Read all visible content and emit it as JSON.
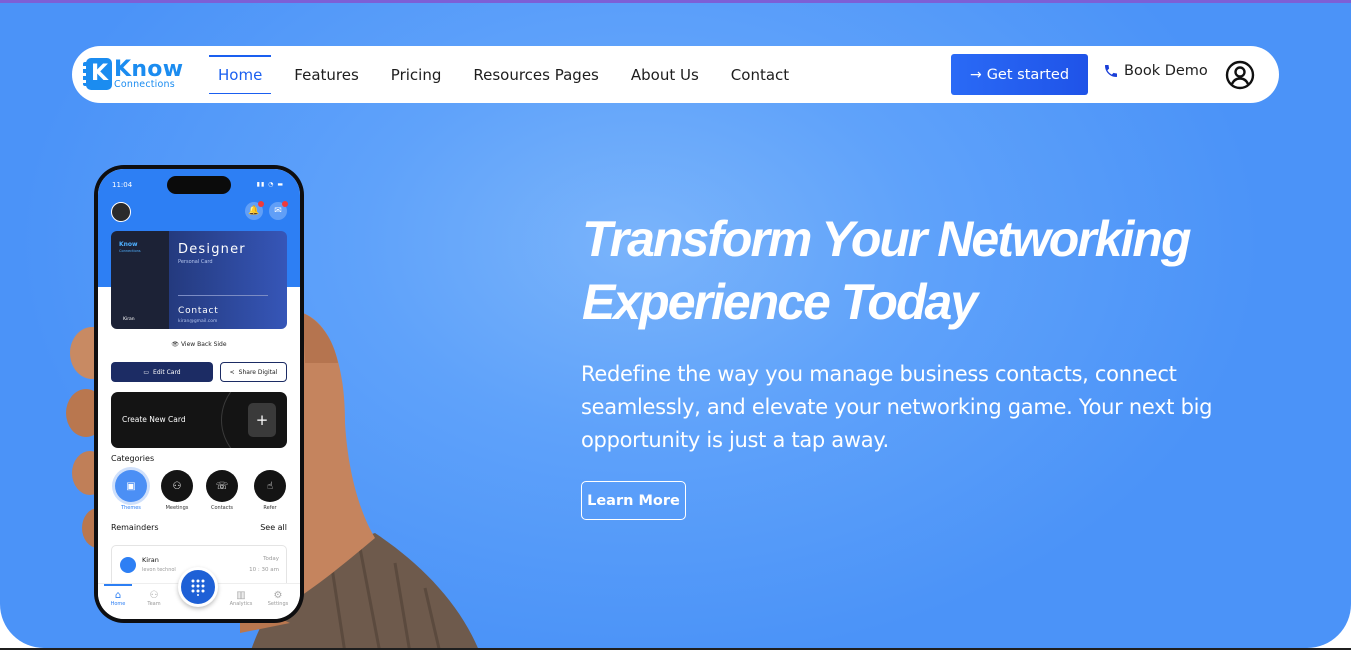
{
  "brand": {
    "name": "Know",
    "tagline": "Connections"
  },
  "nav": {
    "links": [
      {
        "label": "Home",
        "active": true
      },
      {
        "label": "Features"
      },
      {
        "label": "Pricing"
      },
      {
        "label": "Resources Pages"
      },
      {
        "label": "About Us"
      },
      {
        "label": "Contact"
      }
    ],
    "cta_label": "Get started",
    "book_demo_label": "Book Demo"
  },
  "hero": {
    "title_line1": "Transform Your Networking",
    "title_line2": "Experience Today",
    "subtitle": "Redefine the way you manage business contacts, connect seamlessly, and elevate your networking game. Your next big opportunity is just a tap away.",
    "learn_more_label": "Learn More"
  },
  "phone": {
    "time": "11:04",
    "card": {
      "logo_line1": "Know",
      "logo_line2": "Connections",
      "owner": "Kiran",
      "title": "Designer",
      "subtitle": "Personal Card",
      "contact_label": "Contact",
      "email": "kiran@gmail.com"
    },
    "view_back_label": "View Back Side",
    "edit_card_label": "Edit Card",
    "share_label": "Share Digital",
    "create_card_label": "Create New Card",
    "categories_title": "Categories",
    "categories": [
      "Themes",
      "Meetings",
      "Contacts",
      "Refer"
    ],
    "reminders_title": "Remainders",
    "see_all_label": "See all",
    "reminder": {
      "name": "Kiran",
      "company": "levon technol",
      "day": "Today",
      "time": "10 : 30 am"
    },
    "tabs": [
      "Home",
      "Team",
      "Analytics",
      "Settings"
    ]
  },
  "colors": {
    "hero_bg": "#5fa2fa",
    "accent": "#1f53e8",
    "brand": "#1b8cf0",
    "top_border": "#7d5fd6"
  }
}
